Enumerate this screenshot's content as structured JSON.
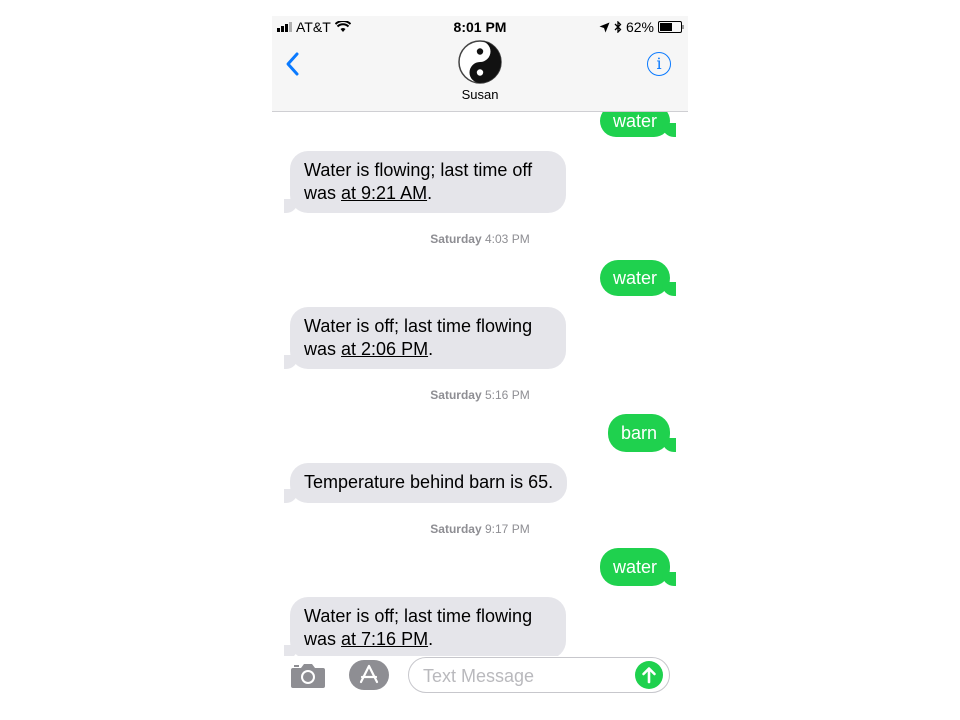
{
  "status_bar": {
    "carrier": "AT&T",
    "time": "8:01 PM",
    "battery": "62%",
    "battery_level": 0.62
  },
  "header": {
    "contact_name": "Susan",
    "avatar_icon": "yin-yang-icon",
    "back_icon": "chevron-left-icon",
    "info_icon": "info-circle-icon"
  },
  "messages": [
    {
      "direction": "out",
      "text": "water"
    },
    {
      "direction": "in",
      "text_before": "Water is flowing; last time off was ",
      "link": "at 9:21 AM",
      "text_after": "."
    },
    {
      "timestamp_day": "Saturday",
      "timestamp_time": "4:03 PM"
    },
    {
      "direction": "out",
      "text": "water"
    },
    {
      "direction": "in",
      "text_before": "Water is off; last time flowing was ",
      "link": "at 2:06 PM",
      "text_after": "."
    },
    {
      "timestamp_day": "Saturday",
      "timestamp_time": "5:16 PM"
    },
    {
      "direction": "out",
      "text": "barn"
    },
    {
      "direction": "in",
      "text": "Temperature behind barn is 65."
    },
    {
      "timestamp_day": "Saturday",
      "timestamp_time": "9:17 PM"
    },
    {
      "direction": "out",
      "text": "water"
    },
    {
      "direction": "in",
      "text_before": "Water is off; last time flowing was ",
      "link": "at 7:16 PM",
      "text_after": "."
    }
  ],
  "input_bar": {
    "placeholder": "Text Message",
    "camera_icon": "camera-icon",
    "apps_icon": "app-store-icon",
    "send_icon": "send-arrow-icon"
  },
  "colors": {
    "outgoing_bubble": "#1fd14e",
    "incoming_bubble": "#e5e5ea",
    "accent": "#0a7aff"
  }
}
